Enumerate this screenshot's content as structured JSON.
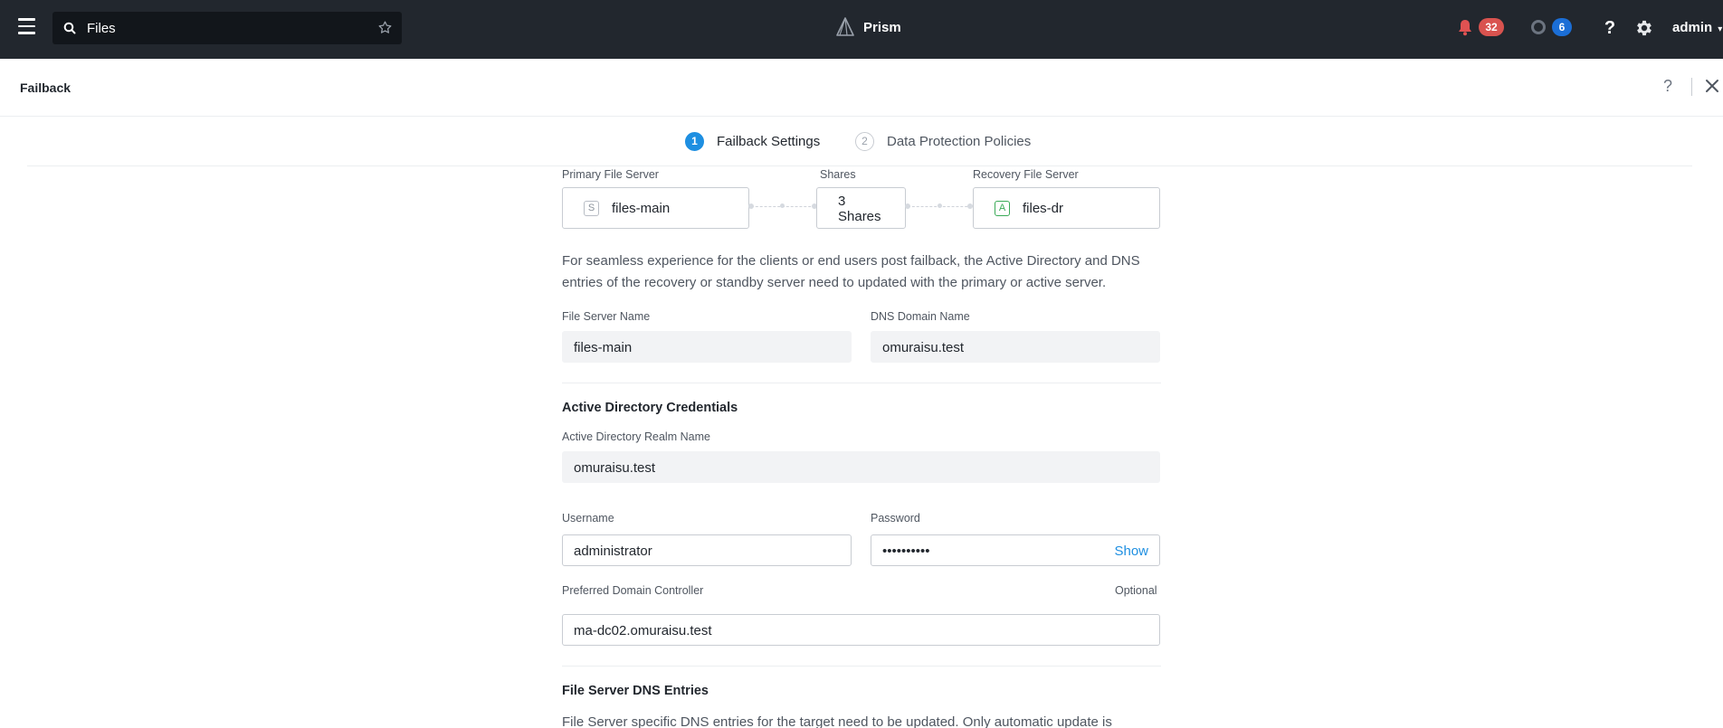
{
  "topbar": {
    "search_value": "Files",
    "brand": "Prism",
    "alerts_count": "32",
    "tasks_count": "6",
    "user": "admin"
  },
  "modal": {
    "title": "Failback"
  },
  "steps": [
    {
      "num": "1",
      "label": "Failback Settings"
    },
    {
      "num": "2",
      "label": "Data Protection Policies"
    }
  ],
  "replication": {
    "primary_caption": "Primary File Server",
    "primary_badge": "S",
    "primary_name": "files-main",
    "shares_caption": "Shares",
    "shares_line1": "3",
    "shares_line2": "Shares",
    "recovery_caption": "Recovery File Server",
    "recovery_badge": "A",
    "recovery_name": "files-dr"
  },
  "description": "For seamless experience for the clients or end users post failback, the Active Directory and DNS entries of the recovery or standby server need to updated with the primary or active server.",
  "form": {
    "file_server_name_label": "File Server Name",
    "file_server_name_value": "files-main",
    "dns_domain_label": "DNS Domain Name",
    "dns_domain_value": "omuraisu.test",
    "ad_section_title": "Active Directory Credentials",
    "ad_realm_label": "Active Directory Realm Name",
    "ad_realm_value": "omuraisu.test",
    "username_label": "Username",
    "username_value": "administrator",
    "password_label": "Password",
    "password_value": "••••••••••",
    "password_show": "Show",
    "dc_label": "Preferred Domain Controller",
    "dc_optional": "Optional",
    "dc_value": "ma-dc02.omuraisu.test",
    "dns_section_title": "File Server DNS Entries",
    "dns_section_desc": "File Server specific DNS entries for the target need to be updated. Only automatic update is"
  },
  "colors": {
    "topbar": "#22272e",
    "accent": "#1e8fe1",
    "alert_red": "#d9534f",
    "task_blue": "#1b6ed6"
  }
}
